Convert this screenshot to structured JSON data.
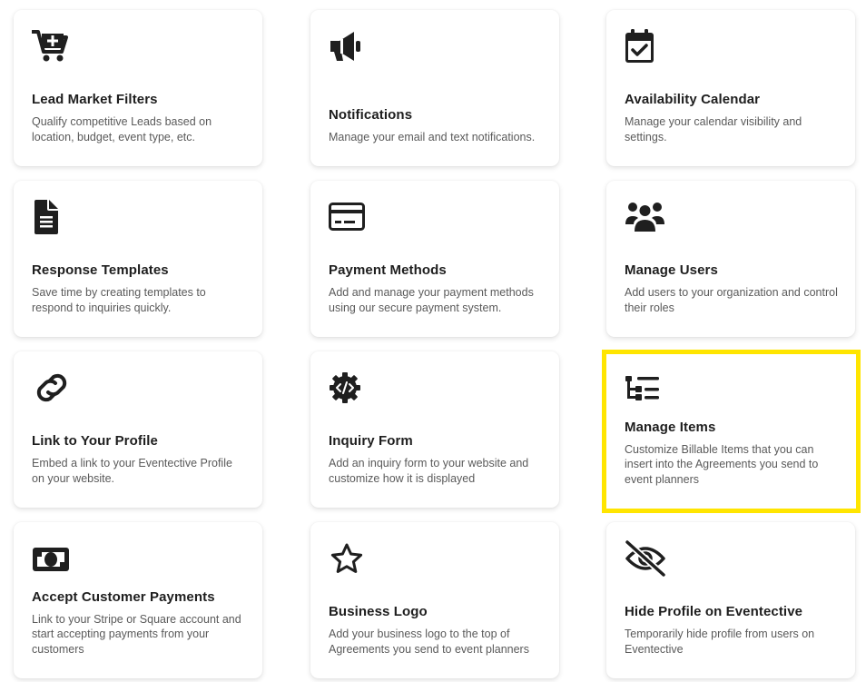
{
  "cards": [
    {
      "title": "Lead Market Filters",
      "description": "Qualify competitive Leads based on location, budget, event type, etc.",
      "icon": "cart-plus-icon"
    },
    {
      "title": "Notifications",
      "description": "Manage your email and text notifications.",
      "icon": "megaphone-icon"
    },
    {
      "title": "Availability Calendar",
      "description": "Manage your calendar visibility and settings.",
      "icon": "calendar-check-icon"
    },
    {
      "title": "Response Templates",
      "description": "Save time by creating templates to respond to inquiries quickly.",
      "icon": "file-lines-icon"
    },
    {
      "title": "Payment Methods",
      "description": "Add and manage your payment methods using our secure payment system.",
      "icon": "credit-card-icon"
    },
    {
      "title": "Manage Users",
      "description": "Add users to your organization and control their roles",
      "icon": "users-icon"
    },
    {
      "title": "Link to Your Profile",
      "description": "Embed a link to your Eventective Profile on your website.",
      "icon": "link-icon"
    },
    {
      "title": "Inquiry Form",
      "description": "Add an inquiry form to your website and customize how it is displayed",
      "icon": "gear-code-icon"
    },
    {
      "title": "Manage Items",
      "description": "Customize Billable Items that you can insert into the Agreements you send to event planners",
      "icon": "list-tree-icon"
    },
    {
      "title": "Accept Customer Payments",
      "description": "Link to your Stripe or Square account and start accepting payments from your customers",
      "icon": "money-bill-icon"
    },
    {
      "title": "Business Logo",
      "description": "Add your business logo to the top of Agreements you send to event planners",
      "icon": "star-icon"
    },
    {
      "title": "Hide Profile on Eventective",
      "description": "Temporarily hide profile from users on Eventective",
      "icon": "eye-slash-icon"
    }
  ],
  "highlight_color": "#ffe500",
  "icon_color": "#1f1f1f"
}
